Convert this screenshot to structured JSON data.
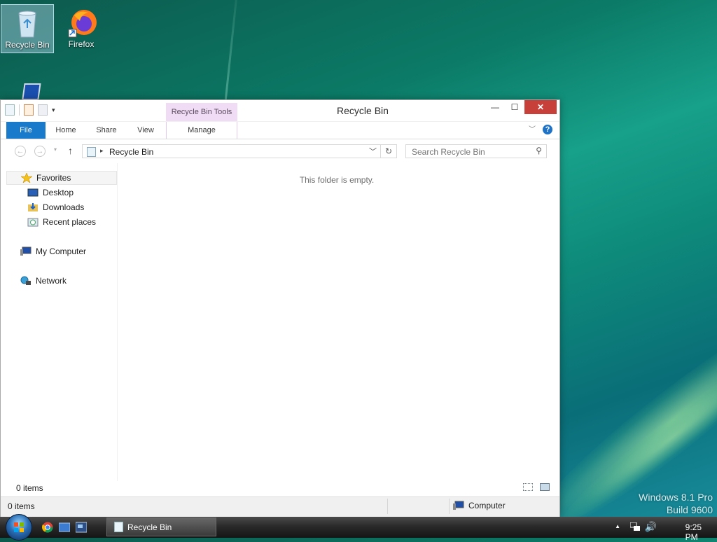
{
  "desktop": {
    "icons": [
      {
        "label": "Recycle Bin"
      },
      {
        "label": "Firefox"
      }
    ],
    "watermark": {
      "line1": "Windows 8.1 Pro",
      "line2": "Build 9600"
    }
  },
  "window": {
    "title": "Recycle Bin",
    "context_tab_group": "Recycle Bin Tools",
    "ribbon_tabs": {
      "file": "File",
      "home": "Home",
      "share": "Share",
      "view": "View",
      "manage": "Manage"
    },
    "address": {
      "location": "Recycle Bin"
    },
    "search": {
      "placeholder": "Search Recycle Bin"
    },
    "nav_pane": {
      "favorites": "Favorites",
      "desktop": "Desktop",
      "downloads": "Downloads",
      "recent_places": "Recent places",
      "my_computer": "My Computer",
      "network": "Network"
    },
    "empty_message": "This folder is empty.",
    "item_count": "0 items",
    "statusbar": {
      "item_count": "0 items",
      "zone": "Computer"
    }
  },
  "taskbar": {
    "task_label": "Recycle Bin",
    "clock": "9:25 PM"
  },
  "colors": {
    "file_tab": "#1979ca",
    "close_button": "#c7403a",
    "context_tab": "#f0dcf4"
  }
}
